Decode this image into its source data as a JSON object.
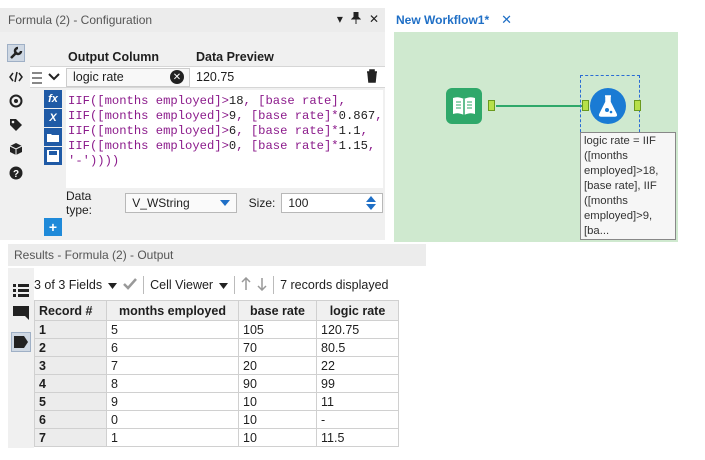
{
  "config": {
    "title": "Formula (2) - Configuration",
    "title_buttons": [
      "▾",
      "📌",
      "✕"
    ],
    "headers": {
      "output_column": "Output Column",
      "data_preview": "Data Preview"
    },
    "row": {
      "output_column": "logic rate",
      "preview": "120.75"
    },
    "expression_lines": [
      {
        "pre": "IIF([months employed]>",
        "num": "18",
        "post": ", [base rate],"
      },
      {
        "pre": "IIF([months employed]>",
        "num": "9",
        "post": ", [base rate]*",
        "num2": "0.867",
        "post2": ","
      },
      {
        "pre": "IIF([months employed]>",
        "num": "6",
        "post": ", [base rate]*",
        "num2": "1.1",
        "post2": ","
      },
      {
        "pre": "IIF([months employed]>",
        "num": "0",
        "post": ", [base rate]*",
        "num2": "1.15",
        "post2": ","
      },
      {
        "pre": "'-'))))",
        "num": "",
        "post": ""
      }
    ],
    "data_type_label": "Data type:",
    "data_type_value": "V_WString",
    "size_label": "Size:",
    "size_value": "100",
    "add_label": "+"
  },
  "workflow": {
    "tab_label": "New Workflow1*",
    "close_label": "✕",
    "annotation": "logic rate = IIF ([months employed]>18, [base rate], IIF ([months employed]>9, [ba..."
  },
  "results": {
    "title": "Results - Formula (2) - Output",
    "fields_label": "3 of 3 Fields",
    "viewer_label": "Cell Viewer",
    "records_label": "7 records displayed",
    "columns": [
      "Record #",
      "months employed",
      "base rate",
      "logic rate"
    ],
    "rows": [
      [
        "1",
        "5",
        "105",
        "120.75"
      ],
      [
        "2",
        "6",
        "70",
        "80.5"
      ],
      [
        "3",
        "7",
        "20",
        "22"
      ],
      [
        "4",
        "8",
        "90",
        "99"
      ],
      [
        "5",
        "9",
        "10",
        "11"
      ],
      [
        "6",
        "0",
        "10",
        "-"
      ],
      [
        "7",
        "1",
        "10",
        "11.5"
      ]
    ]
  },
  "colors": {
    "accent": "#1f6fc6",
    "canvas": "#cfe9cf",
    "tool_green": "#2fa86a",
    "tool_blue": "#1a7bd4"
  }
}
